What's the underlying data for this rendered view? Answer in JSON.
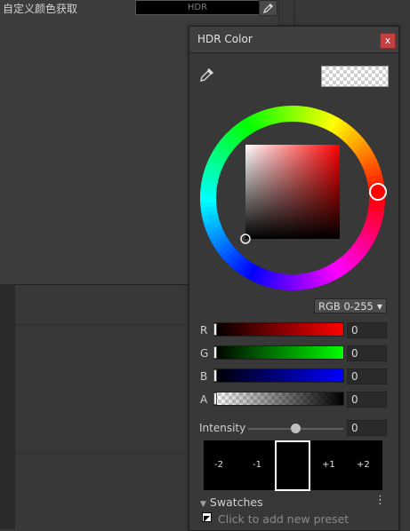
{
  "inspector": {
    "property_label": "自定义颜色获取",
    "field_value": "HDR"
  },
  "popup": {
    "title": "HDR Color",
    "close_label": "x",
    "mode": "RGB 0-255",
    "channels": [
      {
        "label": "R",
        "value": "0",
        "color": "#ff0000"
      },
      {
        "label": "G",
        "value": "0",
        "color": "#00ff00"
      },
      {
        "label": "B",
        "value": "0",
        "color": "#0000ff"
      },
      {
        "label": "A",
        "value": "0"
      }
    ],
    "intensity": {
      "label": "Intensity",
      "value": "0",
      "level": 0.5
    },
    "exposure_stops": [
      "-2",
      "-1",
      "+1",
      "+2"
    ],
    "swatches": {
      "header": "Swatches",
      "add_preset_text": "Click to add new preset"
    }
  },
  "colors": {
    "selected_hue": "#ff0000",
    "accent_close": "#c24040"
  }
}
